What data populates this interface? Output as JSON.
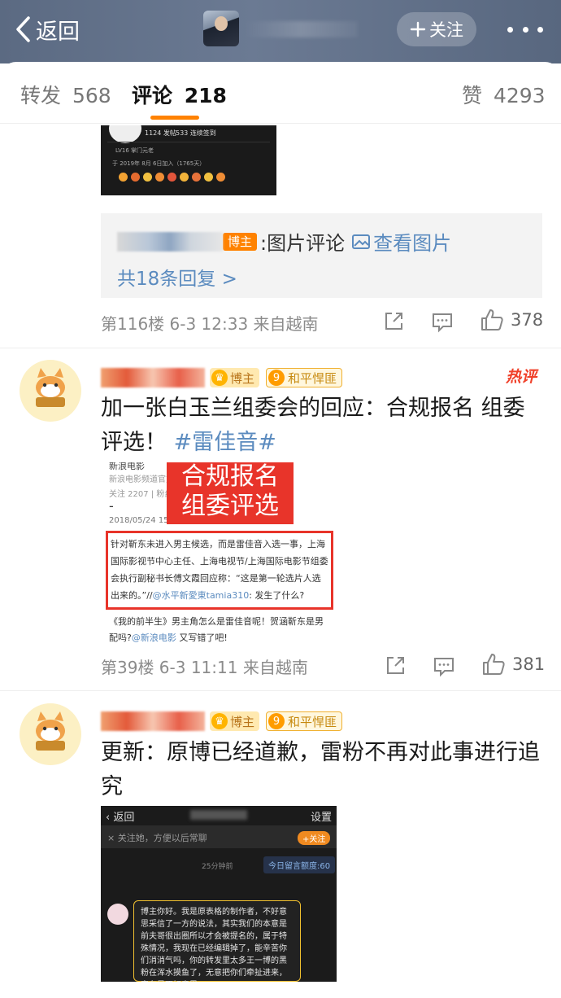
{
  "nav": {
    "back_label": "返回",
    "follow_label": "关注"
  },
  "tabs": [
    {
      "label": "转发",
      "count": "568"
    },
    {
      "label": "评论",
      "count": "218"
    },
    {
      "label": "赞",
      "count": "4293"
    }
  ],
  "comment1": {
    "profile_card": {
      "stat1": "1124 发帖",
      "stat2": "533 连续签到",
      "level": "LV16 掌门元老",
      "joined": "于 2019年 8月 6日加入（1765天）"
    },
    "reply": {
      "owner_badge": "博主",
      "text": ":图片评论",
      "view_pic": "查看图片",
      "more": "共18条回复 >"
    },
    "meta": "第116楼  6-3 12:33  来自越南",
    "likes": "378"
  },
  "comment2": {
    "owner_badge": "博主",
    "fan_level": "9",
    "fan_group": "和平悍匪",
    "hot_label": "热评",
    "text_before": "加一张白玉兰组委会的回应：合规报名 组委评选！",
    "topic": "#雷佳音#",
    "image": {
      "header1": "新浪电影频道官方",
      "header2": "关注 2207 | 粉丝",
      "dash": "-",
      "date": "2018/05/24 15:23",
      "overlay_line1": "合规报名",
      "overlay_line2": "组委评选",
      "body": "针对靳东未进入男主候选，而是雷佳音入选一事，上海国际影视节中心主任、上海电视节/上海国际电影节组委会执行副秘书长傅文霞回应称：“这是第一轮选片人选出来的。”//",
      "mention": "@水平新愛東tamia310",
      "body_end": ": 发生了什么?",
      "tail1": "《我的前半生》男主角怎么是雷佳音呢！贺涵靳东是男配吗?",
      "tail_mention": "@新浪电影",
      "tail2": " 又写错了吧!"
    },
    "meta": "第39楼  6-3 11:11  来自越南",
    "likes": "381"
  },
  "comment3": {
    "owner_badge": "博主",
    "fan_level": "9",
    "fan_group": "和平悍匪",
    "text": "更新：原博已经道歉，雷粉不再对此事进行追究",
    "image": {
      "back": "返回",
      "settings": "设置",
      "notice": "关注她，方便以后常聊",
      "follow": "+关注",
      "time": "25分钟前",
      "quota": "今日留言额度:60",
      "message": "博主你好。我是原表格的制作者，不好意思采信了一方的说法，其实我们的本意是前夫哥很出圈所以才会被提名的，属于特殊情况，我现在已经编辑掉了，能辛苦你们消消气吗，你的转发里太多王一博的黑粉在浑水摸鱼了，无意把你们牵扯进来，实在是不好意思。"
    }
  },
  "colors": {
    "accent": "#ff8200",
    "link": "#5b8bbf",
    "hot": "#f0412a",
    "highlight_red": "#e8342a"
  }
}
